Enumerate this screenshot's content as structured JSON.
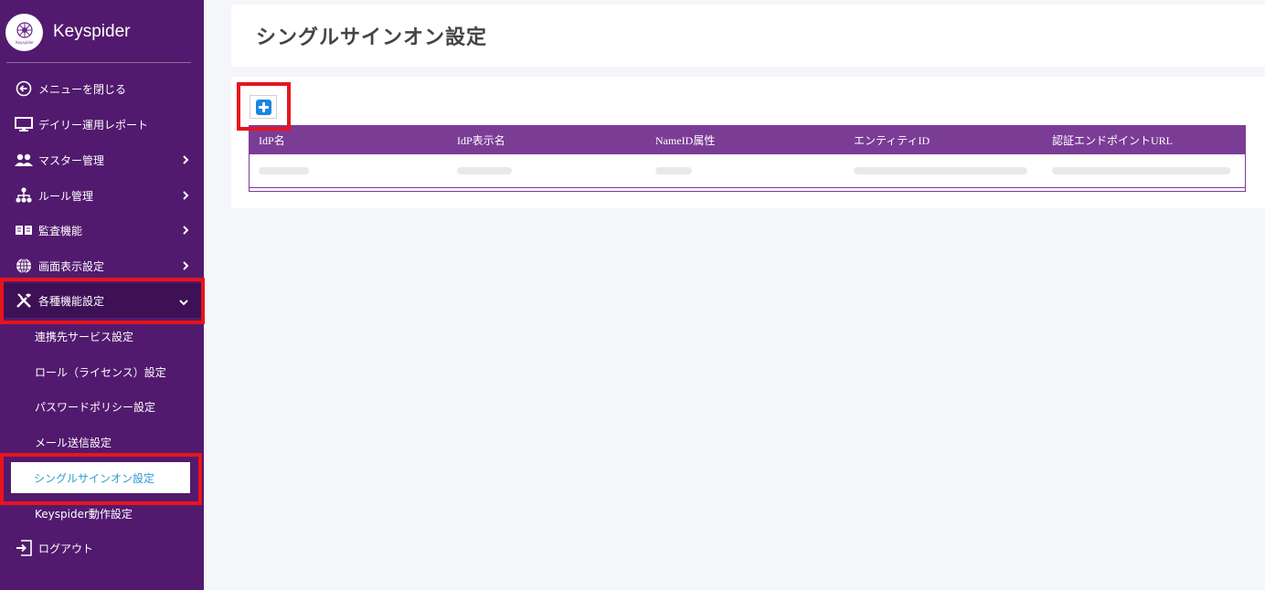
{
  "brand": {
    "name": "Keyspider",
    "logo_text": "Keyspider"
  },
  "sidebar": {
    "items": [
      {
        "label": "メニューを閉じる",
        "icon": "arrow-left-circle-icon"
      },
      {
        "label": "デイリー運用レポート",
        "icon": "monitor-icon"
      },
      {
        "label": "マスター管理",
        "icon": "users-icon"
      },
      {
        "label": "ルール管理",
        "icon": "hierarchy-icon"
      },
      {
        "label": "監査機能",
        "icon": "book-icon"
      },
      {
        "label": "画面表示設定",
        "icon": "globe-icon"
      },
      {
        "label": "各種機能設定",
        "icon": "tools-icon"
      }
    ],
    "sub_items": [
      {
        "label": "連携先サービス設定"
      },
      {
        "label": "ロール（ライセンス）設定"
      },
      {
        "label": "パスワードポリシー設定"
      },
      {
        "label": "メール送信設定"
      },
      {
        "label": "シングルサインオン設定"
      },
      {
        "label": "Keyspider動作設定"
      }
    ],
    "logout": {
      "label": "ログアウト",
      "icon": "logout-icon"
    }
  },
  "page": {
    "title": "シングルサインオン設定"
  },
  "table": {
    "columns": [
      "IdP名",
      "IdP表示名",
      "NameID属性",
      "エンティティID",
      "認証エンドポイントURL"
    ]
  },
  "colors": {
    "sidebar": "#521a6e",
    "table_header": "#7b3c96",
    "highlight": "#e8141c",
    "selected_text": "#2f9bd6",
    "add_button": "#1b87e0"
  }
}
